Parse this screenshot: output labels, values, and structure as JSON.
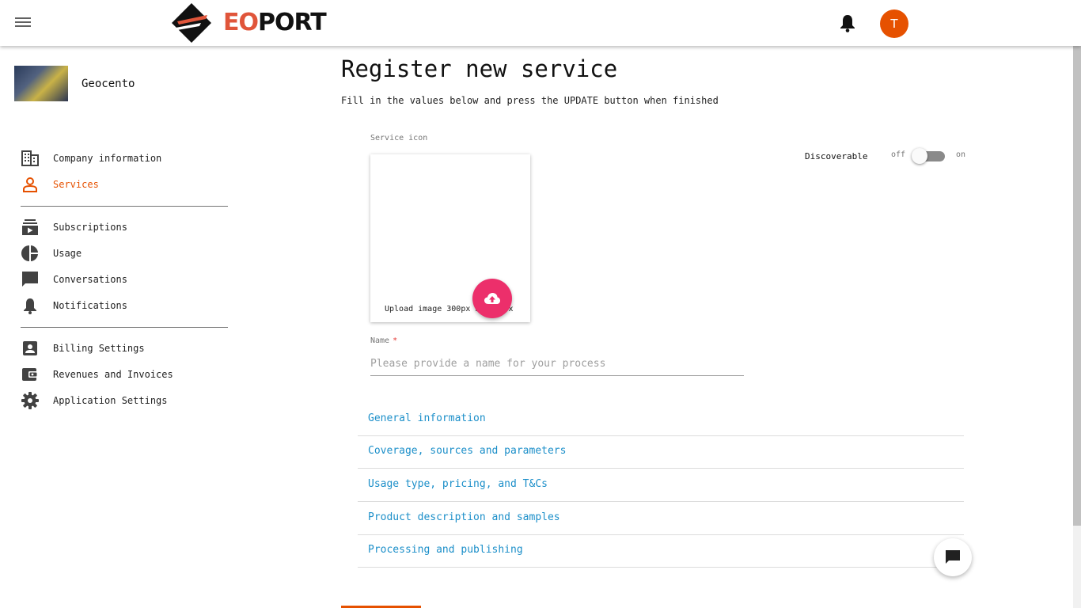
{
  "header": {
    "logo_text_eo": "EO",
    "logo_text_port": "PORT",
    "avatar_initial": "T",
    "brand_color": "#e65100"
  },
  "sidebar": {
    "company_name": "Geocento",
    "items": [
      {
        "label": "Company information",
        "icon": "building-icon"
      },
      {
        "label": "Services",
        "icon": "person-icon",
        "active": true
      },
      {
        "label": "Subscriptions",
        "icon": "subscriptions-icon"
      },
      {
        "label": "Usage",
        "icon": "pie-chart-icon"
      },
      {
        "label": "Conversations",
        "icon": "chat-icon"
      },
      {
        "label": "Notifications",
        "icon": "bell-icon"
      },
      {
        "label": "Billing Settings",
        "icon": "account-box-icon"
      },
      {
        "label": "Revenues and Invoices",
        "icon": "wallet-icon"
      },
      {
        "label": "Application Settings",
        "icon": "gear-icon"
      }
    ]
  },
  "main": {
    "title": "Register new service",
    "subtitle": "Fill in the values below and press the UPDATE button when finished",
    "service_icon_label": "Service icon",
    "upload_text": "Upload image 300px by 300px",
    "discoverable_label": "Discoverable",
    "toggle_off": "off",
    "toggle_on": "on",
    "toggle_state": "off",
    "name_label": "Name",
    "name_required_mark": "*",
    "name_placeholder": "Please provide a name for your process",
    "name_value": "",
    "sections": [
      "General information",
      "Coverage, sources and parameters",
      "Usage type, pricing, and T&Cs",
      "Product description and samples",
      "Processing and publishing"
    ]
  },
  "colors": {
    "link": "#1c8fc9",
    "upload_fab": "#ec2f6b",
    "active_nav": "#e65100"
  }
}
